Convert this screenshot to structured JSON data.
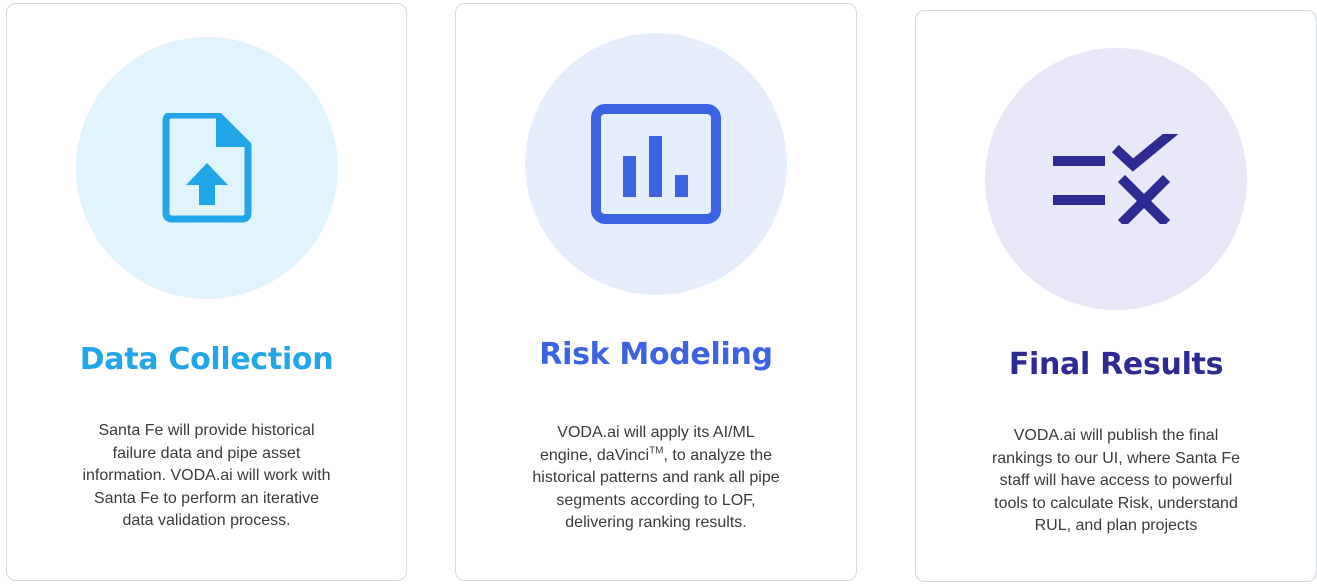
{
  "colors": {
    "card_1_accent": "#23a6e9",
    "card_2_accent": "#3c64e2",
    "card_3_accent": "#2e2a93",
    "card_border": "#d6d9de",
    "text": "#3a3a3a"
  },
  "cards": [
    {
      "icon": "file-upload-icon",
      "title": "Data Collection",
      "description": "Santa Fe will provide historical failure data and pipe asset information. VODA.ai will work with Santa Fe to perform an iterative data validation process."
    },
    {
      "icon": "bar-chart-icon",
      "title": "Risk Modeling",
      "description_before": "VODA.ai will apply its AI/ML engine, daVinci",
      "description_sup": "TM",
      "description_after": ", to analyze the historical patterns and rank all pipe segments according to LOF, delivering ranking results."
    },
    {
      "icon": "checklist-icon",
      "title": "Final Results",
      "description": "VODA.ai will publish the final rankings to our UI, where Santa Fe staff will have access to powerful tools to calculate Risk, understand RUL, and plan projects"
    }
  ]
}
